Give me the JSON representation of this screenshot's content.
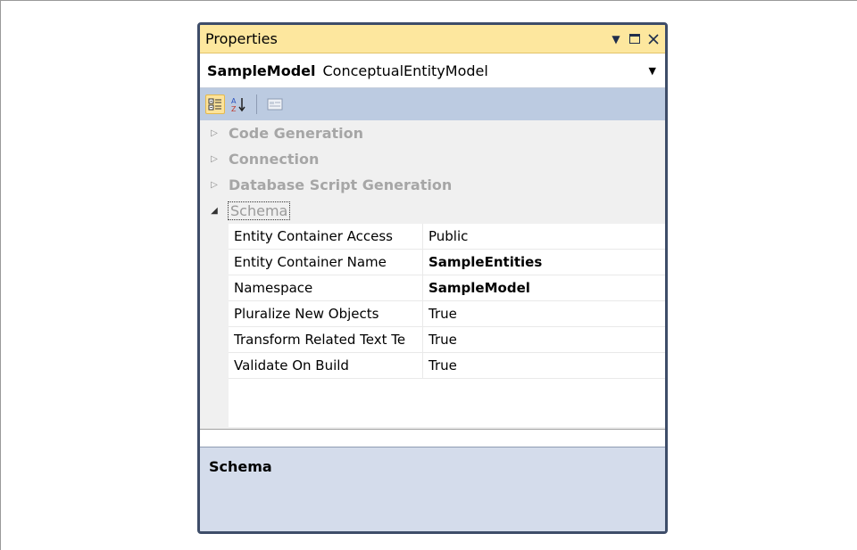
{
  "window": {
    "title": "Properties"
  },
  "object_selector": {
    "name": "SampleModel",
    "type": "ConceptualEntityModel"
  },
  "categories": [
    {
      "label": "Code Generation",
      "expanded": false
    },
    {
      "label": "Connection",
      "expanded": false
    },
    {
      "label": "Database Script Generation",
      "expanded": false
    },
    {
      "label": "Schema",
      "expanded": true
    }
  ],
  "properties": [
    {
      "name": "Entity Container Access",
      "value": "Public"
    },
    {
      "name": "Entity Container Name",
      "value": "SampleEntities"
    },
    {
      "name": "Namespace",
      "value": "SampleModel"
    },
    {
      "name": "Pluralize New Objects",
      "value": "True"
    },
    {
      "name": "Transform Related Text Te",
      "value": "True"
    },
    {
      "name": "Validate On Build",
      "value": "True"
    }
  ],
  "description": {
    "title": "Schema"
  },
  "colors": {
    "title_bar": "#fde79e",
    "toolbar": "#bccbe1",
    "border": "#3e4d69",
    "description_bg": "#d4dceb"
  }
}
